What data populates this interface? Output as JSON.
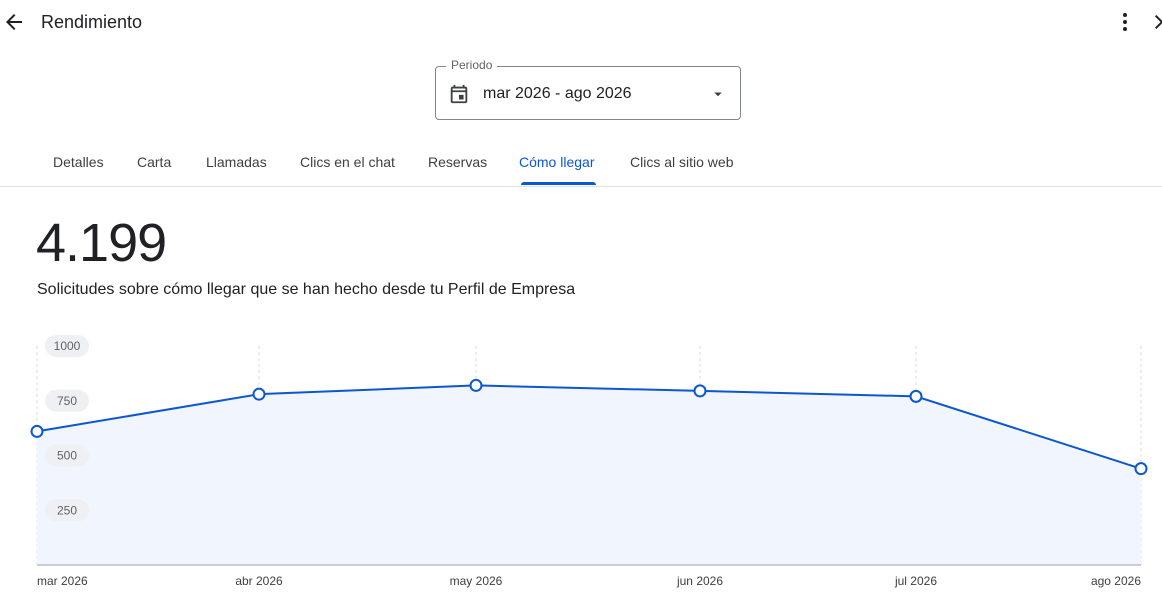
{
  "header": {
    "title": "Rendimiento",
    "back_icon": "arrow-back-icon",
    "more_icon": "more-vert-icon",
    "close_icon": "close-icon"
  },
  "period": {
    "label": "Periodo",
    "value": "mar 2026 - ago 2026",
    "icon": "calendar-icon",
    "dropdown_icon": "arrow-drop-down-icon"
  },
  "tabs": [
    {
      "label": "Detalles",
      "active": false
    },
    {
      "label": "Carta",
      "active": false
    },
    {
      "label": "Llamadas",
      "active": false
    },
    {
      "label": "Clics en el chat",
      "active": false
    },
    {
      "label": "Reservas",
      "active": false
    },
    {
      "label": "Cómo llegar",
      "active": true
    },
    {
      "label": "Clics al sitio web",
      "active": false
    }
  ],
  "summary": {
    "total": "4.199",
    "description": "Solicitudes sobre cómo llegar que se han hecho desde tu Perfil de Empresa"
  },
  "colors": {
    "accent": "#0b57d0",
    "area_fill": "#f1f5fd",
    "text": "#202124"
  },
  "chart_data": {
    "type": "area",
    "categories": [
      "mar 2026",
      "abr 2026",
      "may 2026",
      "jun 2026",
      "jul 2026",
      "ago 2026"
    ],
    "values": [
      610,
      780,
      820,
      795,
      770,
      440
    ],
    "ylim": [
      0,
      1000
    ],
    "yticks": [
      "250",
      "500",
      "750",
      "1000"
    ],
    "grid": "vertical dashed"
  }
}
